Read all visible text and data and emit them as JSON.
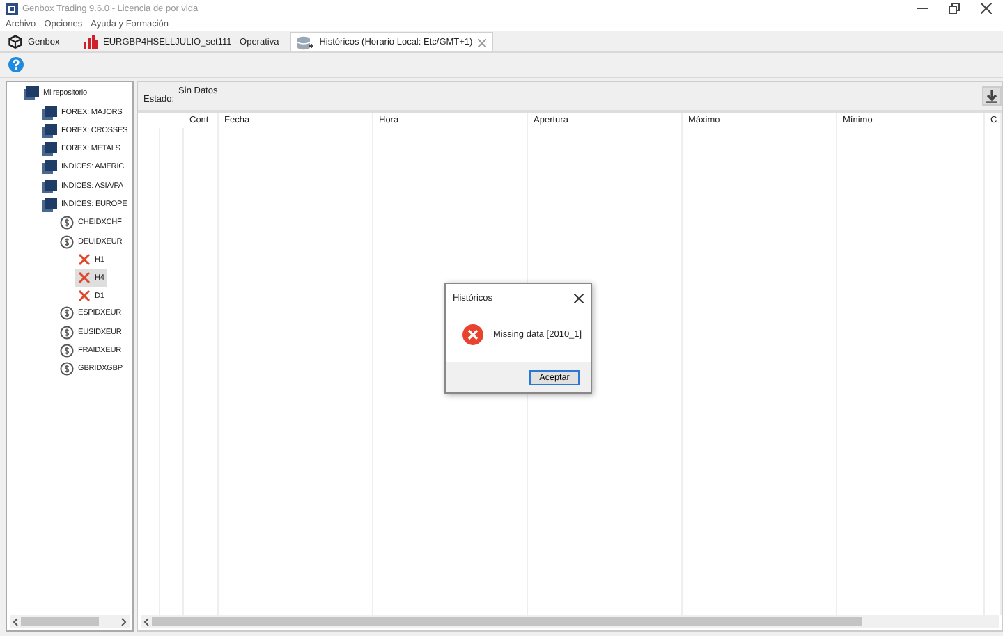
{
  "window": {
    "title": "Genbox Trading 9.6.0 - Licencia de por vida"
  },
  "menu": [
    "Archivo",
    "Opciones",
    "Ayuda y Formación"
  ],
  "tabs": [
    {
      "label": "Genbox",
      "kind": "home",
      "selected": false,
      "closable": false
    },
    {
      "label": "EURGBP4HSELLJULIO_set111 - Operativa",
      "kind": "chart",
      "selected": false,
      "closable": false
    },
    {
      "label": "Históricos (Horario Local: Etc/GMT+1)",
      "kind": "data",
      "selected": true,
      "closable": true
    }
  ],
  "tree": {
    "label": "Mi repositorio",
    "kind": "root",
    "selected": false,
    "children": [
      {
        "label": "FOREX: MAJORS",
        "kind": "folder",
        "selected": false
      },
      {
        "label": "FOREX: CROSSES",
        "kind": "folder",
        "selected": false
      },
      {
        "label": "FOREX: METALS",
        "kind": "folder",
        "selected": false
      },
      {
        "label": "INDICES: AMERIC",
        "kind": "folder",
        "selected": false
      },
      {
        "label": "INDICES: ASIA/PA",
        "kind": "folder",
        "selected": false
      },
      {
        "label": "INDICES: EUROPE",
        "kind": "folder",
        "selected": false,
        "children": [
          {
            "label": "CHEIDXCHF",
            "kind": "symbol",
            "selected": false
          },
          {
            "label": "DEUIDXEUR",
            "kind": "symbol",
            "selected": false,
            "children": [
              {
                "label": "H1",
                "kind": "timeframe",
                "selected": false
              },
              {
                "label": "H4",
                "kind": "timeframe",
                "selected": true
              },
              {
                "label": "D1",
                "kind": "timeframe",
                "selected": false
              }
            ]
          },
          {
            "label": "ESPIDXEUR",
            "kind": "symbol",
            "selected": false
          },
          {
            "label": "EUSIDXEUR",
            "kind": "symbol",
            "selected": false
          },
          {
            "label": "FRAIDXEUR",
            "kind": "symbol",
            "selected": false
          },
          {
            "label": "GBRIDXGBP",
            "kind": "symbol",
            "selected": false
          }
        ]
      }
    ]
  },
  "status": {
    "label": "Estado:",
    "value": "Sin Datos"
  },
  "table": {
    "columns": [
      "Cont",
      "Fecha",
      "Hora",
      "Apertura",
      "Máximo",
      "Mínimo",
      "C"
    ]
  },
  "dialog": {
    "title": "Históricos",
    "message": "Missing data [2010_1]",
    "button": "Aceptar"
  }
}
